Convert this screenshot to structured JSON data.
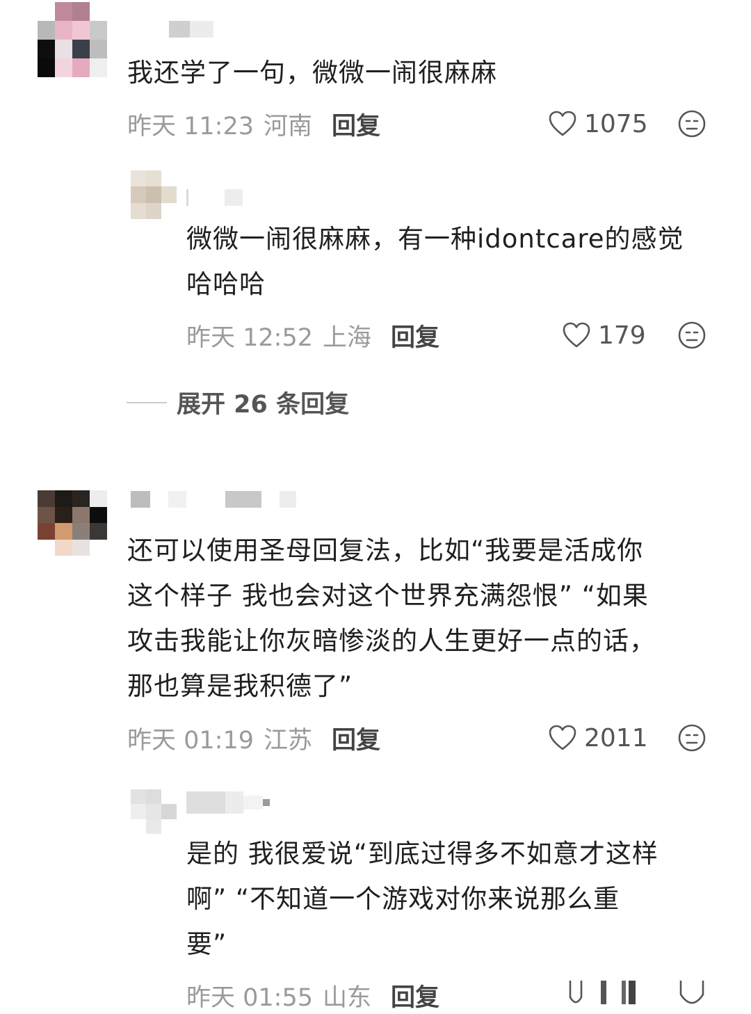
{
  "comments": [
    {
      "text": "我还学了一句，微微一闹很麻麻",
      "time": "昨天 11:23",
      "location": "河南",
      "reply_label": "回复",
      "likes": "1075",
      "avatar_icon": "pixelated-avatar",
      "replies": [
        {
          "text_line1": "微微一闹很麻麻，有一种idontcare的感觉",
          "text_line2": "哈哈哈",
          "time": "昨天 12:52",
          "location": "上海",
          "reply_label": "回复",
          "likes": "179",
          "avatar_icon": "pixelated-avatar"
        }
      ],
      "expand_label": "展开 26 条回复"
    },
    {
      "text_lines": [
        "还可以使用圣母回复法，比如“我要是活成你",
        "这个样子 我也会对这个世界充满怨恨” “如果",
        "攻击我能让你灰暗惨淡的人生更好一点的话，",
        "那也算是我积德了”"
      ],
      "time": "昨天 01:19",
      "location": "江苏",
      "reply_label": "回复",
      "likes": "2011",
      "avatar_icon": "pixelated-avatar",
      "replies": [
        {
          "text_lines": [
            "是的 我很爱说“到底过得多不如意才这样",
            "啊” “不知道一个游戏对你来说那么重",
            "要”"
          ],
          "time": "昨天 01:55",
          "location": "山东",
          "reply_label": "回复",
          "avatar_icon": "pixelated-avatar"
        }
      ]
    }
  ],
  "icons": {
    "like": "heart-outline-icon",
    "dislike": "meh-face-icon"
  },
  "colors": {
    "meta_text": "#9a9a9a",
    "body_text": "#1f1f1f",
    "reply_label": "#444444"
  }
}
